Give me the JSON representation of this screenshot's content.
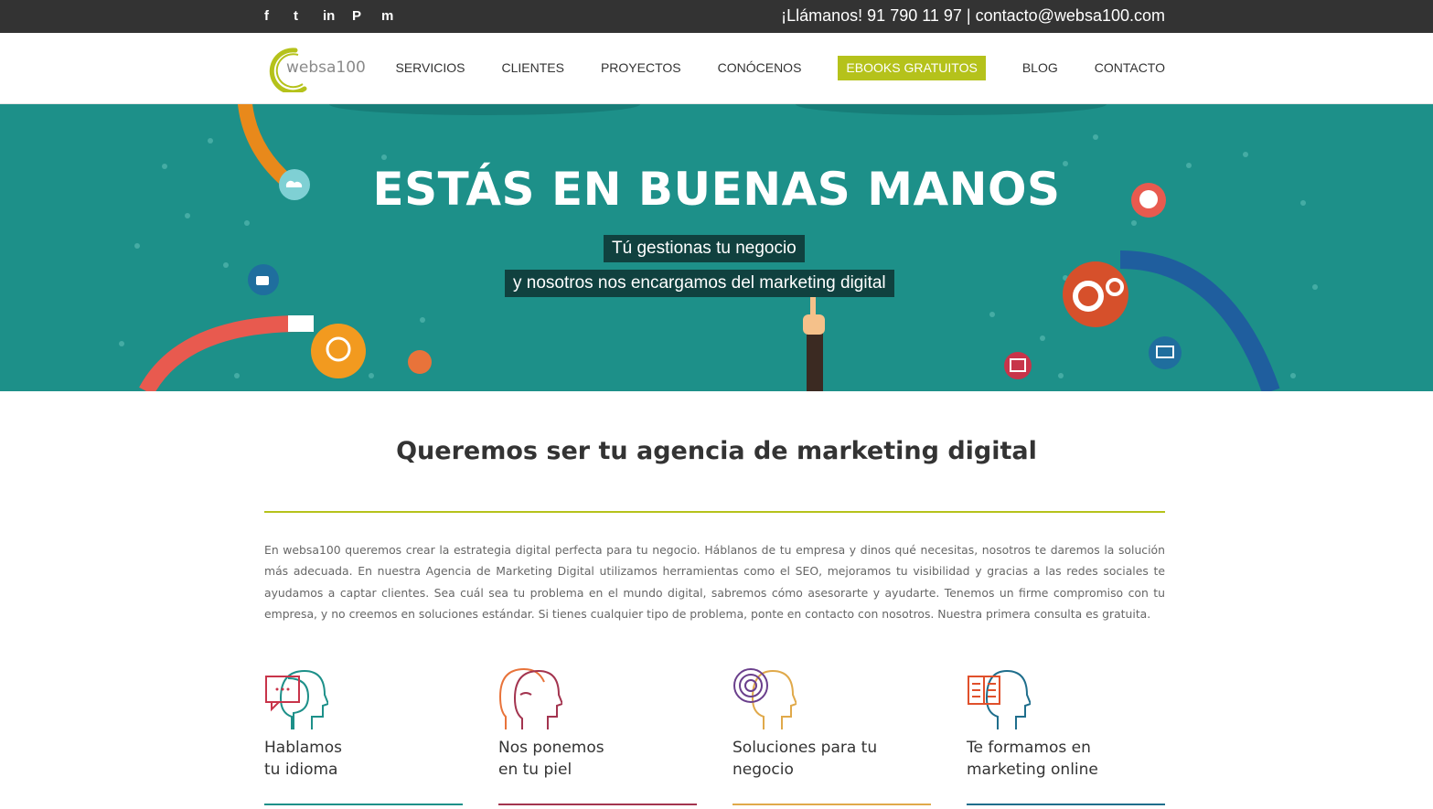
{
  "topbar": {
    "social": [
      {
        "icon": "facebook-icon",
        "glyph": "f"
      },
      {
        "icon": "twitter-icon",
        "glyph": "t"
      },
      {
        "icon": "linkedin-icon",
        "glyph": "in"
      },
      {
        "icon": "pinterest-icon",
        "glyph": "P"
      },
      {
        "icon": "meetup-icon",
        "glyph": "m"
      }
    ],
    "contact": "¡Llámanos! 91 790 11 97 | contacto@websa100.com"
  },
  "header": {
    "logo_text": "websa100",
    "nav": [
      {
        "label": "SERVICIOS",
        "highlight": false
      },
      {
        "label": "CLIENTES",
        "highlight": false
      },
      {
        "label": "PROYECTOS",
        "highlight": false
      },
      {
        "label": "CONÓCENOS",
        "highlight": false
      },
      {
        "label": "EBOOKS GRATUITOS",
        "highlight": true
      },
      {
        "label": "BLOG",
        "highlight": false
      },
      {
        "label": "CONTACTO",
        "highlight": false
      }
    ]
  },
  "hero": {
    "title": "ESTÁS EN BUENAS MANOS",
    "subtitle_1": "Tú gestionas tu negocio",
    "subtitle_2": "y nosotros nos encargamos del marketing digital"
  },
  "intro": {
    "title": "Queremos ser tu agencia de marketing digital",
    "text": "En websa100 queremos crear la estrategia digital perfecta para tu negocio. Háblanos de tu empresa y dinos qué necesitas, nosotros te daremos la solución más adecuada. En nuestra Agencia de Marketing Digital utilizamos herramientas como el SEO, mejoramos tu visibilidad y gracias a las redes sociales te ayudamos a captar clientes. Sea cuál sea tu problema en el mundo digital, sabremos cómo asesorarte y ayudarte. Tenemos un firme compromiso con tu empresa, y no creemos en soluciones estándar. Si tienes cualquier tipo de problema, ponte en contacto con nosotros. Nuestra primera consulta es gratuita."
  },
  "features": [
    {
      "label": "Hablamos\ntu idioma",
      "icon": "speech-head-icon",
      "color": "#1d9089"
    },
    {
      "label": "Nos ponemos\nen tu piel",
      "icon": "two-heads-icon",
      "color": "#a3344f"
    },
    {
      "label": "Soluciones para tu\nnegocio",
      "icon": "maze-head-icon",
      "color": "#e0a94a"
    },
    {
      "label": "Te formamos en\nmarketing online",
      "icon": "book-head-icon",
      "color": "#1f6e8c"
    }
  ],
  "colors": {
    "topbar": "#333333",
    "accent": "#b5c21b",
    "hero": "#1d9089",
    "hero_label_bg": "#10413f"
  }
}
